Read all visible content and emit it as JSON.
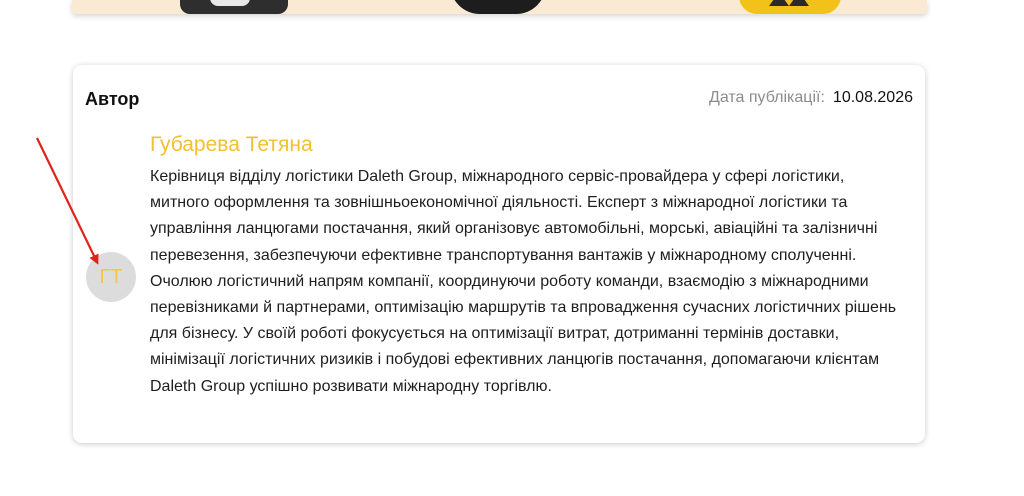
{
  "card": {
    "heading": "Автор",
    "publication_label": "Дата публікації:",
    "publication_date": "10.08.2026"
  },
  "author": {
    "initials": "ГТ",
    "name": "Губарева Тетяна",
    "bio": "Керівниця відділу логістики Daleth Group, міжнародного сервіс-провайдера у сфері логістики, митного оформлення та зовнішньоекономічної діяльності. Експерт з міжнародної логістики та управління ланцюгами постачання, який організовує автомобільні, морські, авіаційні та залізничні перевезення, забезпечуючи ефективне транспортування вантажів у міжнародному сполученні. Очолюю логістичний напрям компанії, координуючи роботу команди, взаємодію з міжнародними перевізниками й партнерами, оптимізацію маршрутів та впровадження сучасних логістичних рішень для бізнесу. У своїй роботі фокусується на оптимізації витрат, дотриманні термінів доставки, мінімізації логістичних ризиків і побудові ефективних ланцюгів постачання, допомагаючи клієнтам Daleth Group успішно розвивати міжнародну торгівлю."
  },
  "colors": {
    "accent": "#f4bf2f",
    "avatar_bg": "#dcdcdc",
    "arrow": "#e0221b"
  }
}
